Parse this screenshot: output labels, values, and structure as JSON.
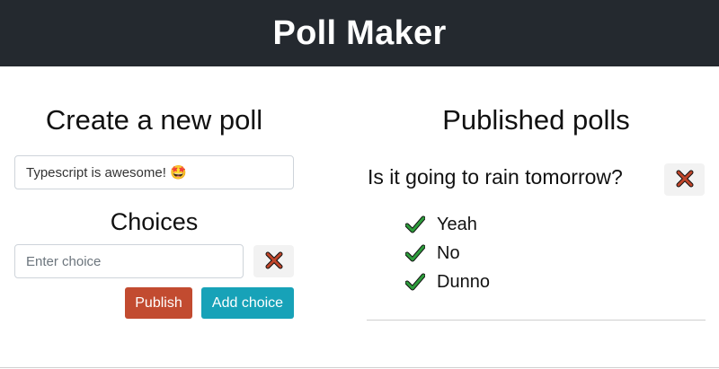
{
  "header": {
    "title": "Poll Maker"
  },
  "create": {
    "title": "Create a new poll",
    "question_value": "Typescript is awesome! 🤩",
    "choices_title": "Choices",
    "choice_placeholder": "Enter choice",
    "publish_label": "Publish",
    "add_choice_label": "Add choice"
  },
  "published": {
    "title": "Published polls",
    "polls": [
      {
        "question": "Is it going to rain tomorrow?",
        "choices": [
          {
            "label": "Yeah"
          },
          {
            "label": "No"
          },
          {
            "label": "Dunno"
          }
        ]
      }
    ]
  },
  "icons": {
    "delete": "cross-mark-icon",
    "choice": "check-mark-icon"
  },
  "colors": {
    "header_bg": "#24292f",
    "publish": "#c24b30",
    "add_choice": "#17a2b8",
    "check": "#2e9c3c",
    "cross": "#c0452a"
  }
}
